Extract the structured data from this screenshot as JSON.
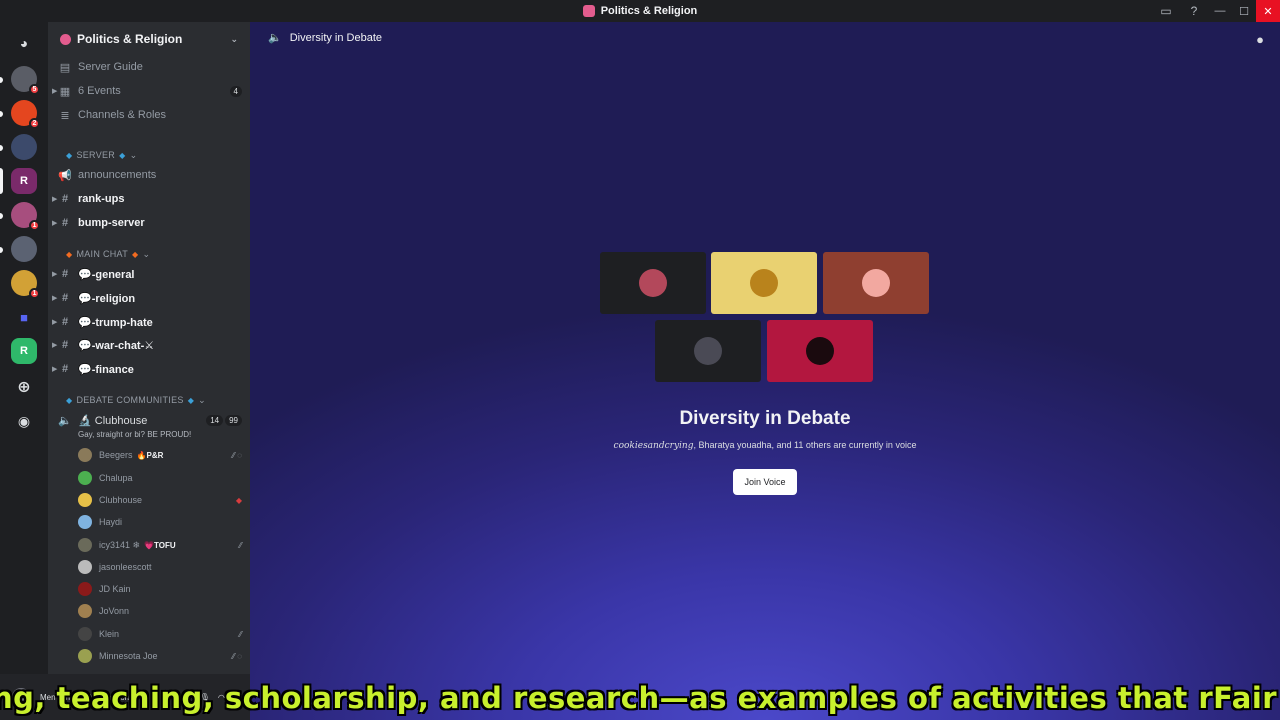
{
  "window": {
    "title": "Politics & Religion"
  },
  "colors": {
    "accent": "#5865f2",
    "discord_bg": "#1e1f22",
    "sidebar_bg": "#2b2d31",
    "caption": "#c8f02d"
  },
  "rail": {
    "servers": [
      {
        "name": "discord-home-icon",
        "badge": ""
      },
      {
        "name": "server-1",
        "badge": "5"
      },
      {
        "name": "server-2",
        "badge": "2"
      },
      {
        "name": "server-3",
        "badge": ""
      },
      {
        "name": "server-4",
        "badge": ""
      },
      {
        "name": "server-5",
        "badge": "1"
      },
      {
        "name": "server-6",
        "badge": ""
      },
      {
        "name": "server-7",
        "badge": "1"
      },
      {
        "name": "server-folder",
        "badge": ""
      },
      {
        "name": "server-r",
        "badge": ""
      }
    ]
  },
  "sidebar": {
    "guild_name": "Politics & Religion",
    "top_items": [
      {
        "label": "Server Guide"
      },
      {
        "label": "6 Events",
        "count": "4"
      },
      {
        "label": "Channels & Roles"
      }
    ],
    "categories": {
      "server": "SERVER",
      "main_chat": "MAIN CHAT",
      "debate": "DEBATE COMMUNITIES"
    },
    "channels": {
      "announcements": "announcements",
      "rank_ups": "rank-ups",
      "bump_server": "bump-server",
      "general": "💬-general",
      "religion": "💬-religion",
      "trump_hate": "💬-trump-hate",
      "war_chat": "💬-war-chat-⚔",
      "finance": "💬-finance"
    },
    "voice": {
      "name": "🔬 Clubhouse",
      "count_a": "14",
      "count_b": "99",
      "subtitle": "Gay, straight or bi? BE PROUD!"
    },
    "users": [
      {
        "name": "Beegers",
        "tag": "🔥P&R"
      },
      {
        "name": "Chalupa",
        "tag": ""
      },
      {
        "name": "Clubhouse",
        "tag": ""
      },
      {
        "name": "Haydi",
        "tag": ""
      },
      {
        "name": "icy3141 ❄",
        "tag": "💗TOFU"
      },
      {
        "name": "jasonleescott",
        "tag": ""
      },
      {
        "name": "JD Kain",
        "tag": ""
      },
      {
        "name": "JoVonn",
        "tag": ""
      },
      {
        "name": "Klein",
        "tag": ""
      },
      {
        "name": "Minnesota Joe",
        "tag": ""
      }
    ]
  },
  "main": {
    "channel_title": "Diversity in Debate",
    "voice_title": "Diversity in Debate",
    "voice_sub_name": "cookiesandcrying",
    "voice_sub_rest": ", Bharatya youadha, and 11 others are currently in voice",
    "join_label": "Join Voice"
  },
  "userbar": {
    "status": "Men's mental health month"
  },
  "caption": {
    "text": "ng, teaching, scholarship, and research—as examples of activities that rFair u"
  }
}
